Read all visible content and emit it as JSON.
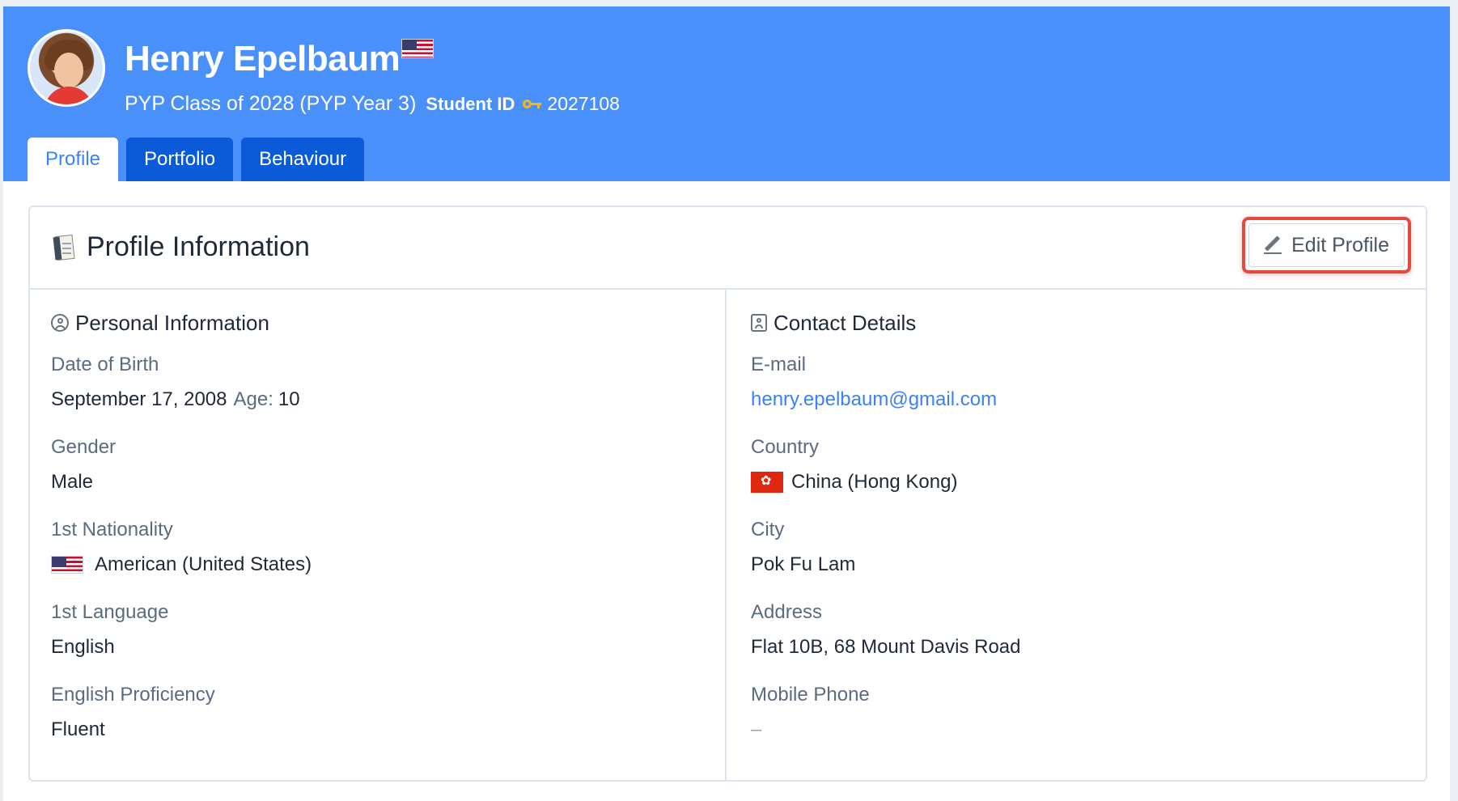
{
  "header": {
    "student_name": "Henry Epelbaum",
    "class_text": "PYP Class of 2028 (PYP Year 3)",
    "student_id_label": "Student ID",
    "student_id_value": "2027108",
    "nationality_flag": "us-flag-icon"
  },
  "tabs": [
    {
      "label": "Profile",
      "active": true
    },
    {
      "label": "Portfolio",
      "active": false
    },
    {
      "label": "Behaviour",
      "active": false
    }
  ],
  "card": {
    "title": "Profile Information",
    "edit_button_label": "Edit Profile"
  },
  "personal": {
    "title": "Personal Information",
    "fields": [
      {
        "label": "Date of Birth",
        "value": "September 17, 2008",
        "age_label": "Age:",
        "age_value": "10"
      },
      {
        "label": "Gender",
        "value": "Male"
      },
      {
        "label": "1st Nationality",
        "value": "American (United States)"
      },
      {
        "label": "1st Language",
        "value": "English"
      },
      {
        "label": "English Proficiency",
        "value": "Fluent"
      }
    ]
  },
  "contact": {
    "title": "Contact Details",
    "fields": [
      {
        "label": "E-mail",
        "value": "henry.epelbaum@gmail.com"
      },
      {
        "label": "Country",
        "value": "China (Hong Kong)"
      },
      {
        "label": "City",
        "value": "Pok Fu Lam"
      },
      {
        "label": "Address",
        "value": "Flat 10B, 68 Mount Davis Road"
      },
      {
        "label": "Mobile Phone",
        "value": "–"
      }
    ]
  },
  "colors": {
    "header_bg": "#4a90fb",
    "tab_bg": "#0b5bd9",
    "accent_link": "#3b82f6",
    "highlight_border": "#e5483c"
  }
}
